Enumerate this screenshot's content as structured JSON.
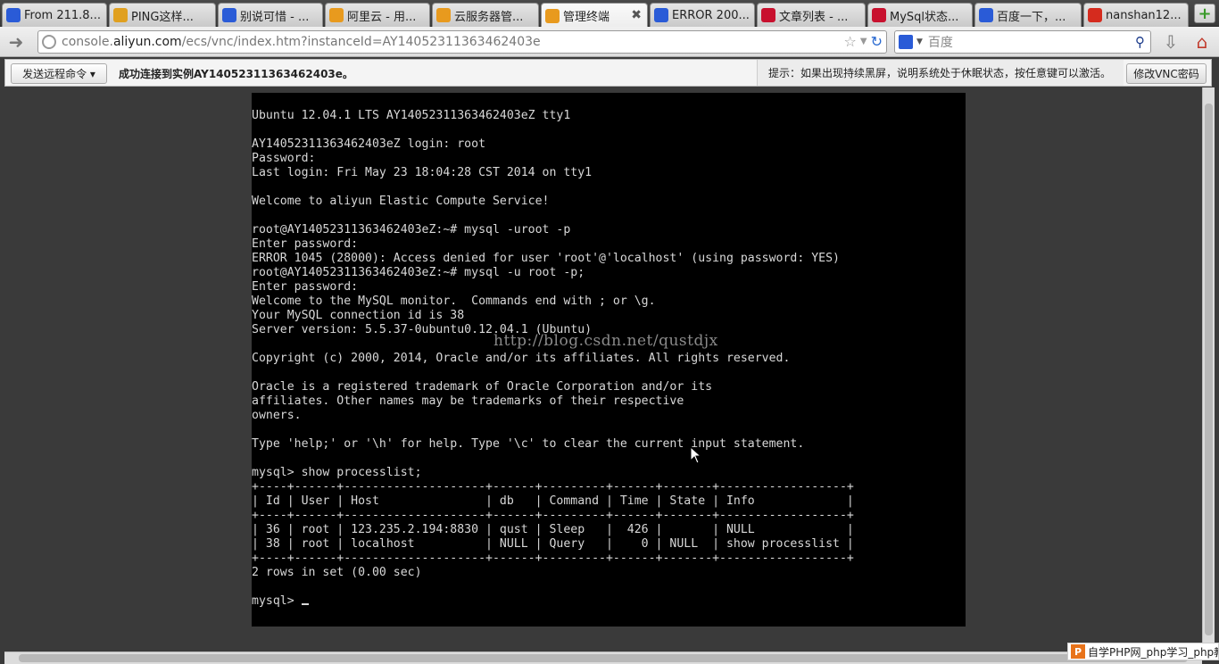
{
  "browser": {
    "tabs": [
      {
        "title": "From 211.8...",
        "favicon": "baidu-paw-icon",
        "color": "#2a5bd7"
      },
      {
        "title": "PING这样...",
        "favicon": "baidu-zhidao-icon",
        "color": "#e0a020"
      },
      {
        "title": "别说可惜 - ...",
        "favicon": "baidu-paw-icon",
        "color": "#2a5bd7"
      },
      {
        "title": "阿里云 - 用...",
        "favicon": "aliyun-icon",
        "color": "#e89a1e"
      },
      {
        "title": "云服务器管...",
        "favicon": "aliyun-icon",
        "color": "#e89a1e"
      },
      {
        "title": "管理终端",
        "favicon": "aliyun-icon",
        "color": "#e89a1e",
        "active": true
      },
      {
        "title": "ERROR 200...",
        "favicon": "baidu-paw-icon",
        "color": "#2a5bd7"
      },
      {
        "title": "文章列表 - ...",
        "favicon": "csdn-icon",
        "color": "#c8102e"
      },
      {
        "title": "MySql状态...",
        "favicon": "csdn-icon",
        "color": "#c8102e"
      },
      {
        "title": "百度一下，...",
        "favicon": "baidu-paw-icon",
        "color": "#2a5bd7"
      },
      {
        "title": "nanshan12...",
        "favicon": "weibo-icon",
        "color": "#d52b1e"
      }
    ],
    "url": {
      "prefix": "console.",
      "domain": "aliyun.com",
      "path": "/ecs/vnc/index.htm?instanceId=AY14052311363462403e"
    },
    "search_placeholder": "百度"
  },
  "vnc_toolbar": {
    "send_command_label": "发送远程命令 ▾",
    "status": "成功连接到实例AY14052311363462403e。",
    "hint": "提示：如果出现持续黑屏，说明系统处于休眠状态，按任意键可以激活。",
    "change_password_label": "修改VNC密码"
  },
  "terminal": {
    "lines": [
      "Ubuntu 12.04.1 LTS AY14052311363462403eZ tty1",
      "",
      "AY14052311363462403eZ login: root",
      "Password:",
      "Last login: Fri May 23 18:04:28 CST 2014 on tty1",
      "",
      "Welcome to aliyun Elastic Compute Service!",
      "",
      "root@AY14052311363462403eZ:~# mysql -uroot -p",
      "Enter password:",
      "ERROR 1045 (28000): Access denied for user 'root'@'localhost' (using password: YES)",
      "root@AY14052311363462403eZ:~# mysql -u root -p;",
      "Enter password:",
      "Welcome to the MySQL monitor.  Commands end with ; or \\g.",
      "Your MySQL connection id is 38",
      "Server version: 5.5.37-0ubuntu0.12.04.1 (Ubuntu)",
      "",
      "Copyright (c) 2000, 2014, Oracle and/or its affiliates. All rights reserved.",
      "",
      "Oracle is a registered trademark of Oracle Corporation and/or its",
      "affiliates. Other names may be trademarks of their respective",
      "owners.",
      "",
      "Type 'help;' or '\\h' for help. Type '\\c' to clear the current input statement.",
      "",
      "mysql> show processlist;",
      "+----+------+--------------------+------+---------+------+-------+------------------+",
      "| Id | User | Host               | db   | Command | Time | State | Info             |",
      "+----+------+--------------------+------+---------+------+-------+------------------+",
      "| 36 | root | 123.235.2.194:8830 | qust | Sleep   |  426 |       | NULL             |",
      "| 38 | root | localhost          | NULL | Query   |    0 | NULL  | show processlist |",
      "+----+------+--------------------+------+---------+------+-------+------------------+",
      "2 rows in set (0.00 sec)",
      ""
    ],
    "prompt": "mysql> ",
    "watermark": "http://blog.csdn.net/qustdjx"
  },
  "badge": {
    "logo": "P",
    "text": "自学PHP网_php学习_php教程"
  }
}
